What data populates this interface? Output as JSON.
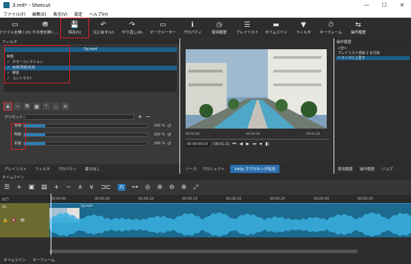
{
  "window": {
    "title": "3.mlt* - Shotcut",
    "minimize": "—",
    "maximize": "☐",
    "close": "✕"
  },
  "menu": [
    "ファイル(F)",
    "編集(E)",
    "表示(V)",
    "設定",
    "ヘルプ(H)"
  ],
  "toolbar": [
    {
      "icon": "▭",
      "label": "ファイルを開く(O)",
      "name": "open-file-button"
    },
    {
      "icon": "⛃",
      "label": "その他を開く...",
      "name": "open-other-button"
    },
    {
      "icon": "💾",
      "label": "保存(S)",
      "name": "save-button",
      "highlight": true
    },
    {
      "icon": "↶",
      "label": "元に戻す(U)",
      "name": "undo-button"
    },
    {
      "icon": "↷",
      "label": "やり直し(R)",
      "name": "redo-button"
    },
    {
      "icon": "▭",
      "label": "ピークメーター",
      "name": "peak-meter-button"
    },
    {
      "icon": "ℹ",
      "label": "プロパティ",
      "name": "properties-button"
    },
    {
      "icon": "◷",
      "label": "使用履歴",
      "name": "recent-button"
    },
    {
      "icon": "☰",
      "label": "プレイリスト",
      "name": "playlist-button"
    },
    {
      "icon": "▬",
      "label": "タイムライン",
      "name": "timeline-button"
    },
    {
      "icon": "▼",
      "label": "フィルタ",
      "name": "filter-button"
    },
    {
      "icon": "⏱",
      "label": "キーフレーム",
      "name": "keyframes-button"
    },
    {
      "icon": "⇆",
      "label": "操作履歴",
      "name": "history-button"
    }
  ],
  "filters": {
    "header": "フィルタ",
    "clip_name": "5g.mp4",
    "section": "映像",
    "items": [
      {
        "check": "✓",
        "label": "カラーコレクション",
        "selected": false
      },
      {
        "check": "✓",
        "label": "色相/明度/彩度",
        "selected": true
      },
      {
        "check": "✓",
        "label": "鮮度",
        "selected": false
      },
      {
        "check": "✓",
        "label": "コントラスト",
        "selected": false
      }
    ],
    "controls": [
      "+",
      "−",
      "⧉",
      "▦",
      "⌃",
      "⌄",
      "✕"
    ],
    "preset_label": "プリセット",
    "preset_add": "+",
    "preset_remove": "−",
    "params": [
      {
        "label": "色相",
        "value": "100",
        "unit": "%",
        "level": 0.17
      },
      {
        "label": "明度",
        "value": "100",
        "unit": "%",
        "level": 0.17
      },
      {
        "label": "彩度",
        "value": "100",
        "unit": "%",
        "level": 0.17
      }
    ],
    "reset": "↺"
  },
  "left_tabs": [
    "プレイリスト",
    "フィルタ",
    "プロパティ",
    "書き出し"
  ],
  "player": {
    "ruler": [
      "00:00:00",
      "00:00:30",
      "00:01:00"
    ],
    "timecode": "00:00:00:03",
    "duration": "/ 00:01:21",
    "buttons": [
      "⏮",
      "◀",
      "▶",
      "⏭",
      "⏹",
      "◧"
    ],
    "tabs": [
      "ソース",
      "プロジェクト"
    ],
    "proxy": "540p でプロキシが有効"
  },
  "history": {
    "header": "操作履歴",
    "items": [
      {
        "label": "<空>",
        "selected": false
      },
      {
        "label": "プレイリスト項目 1 を付加",
        "selected": false
      },
      {
        "label": "トラックに上書き",
        "selected": true
      }
    ]
  },
  "right_tabs": [
    "使用履歴",
    "操作履歴",
    "ジョブ"
  ],
  "timeline": {
    "header": "タイムライン",
    "tools": [
      "☰",
      "+",
      "▣",
      "▤",
      "+",
      "−",
      "∧",
      "∨",
      "⊐⊏",
      "∩",
      "⊶",
      "◎",
      "⊛",
      "⊖",
      "⊕",
      "⤢"
    ],
    "track_header": "出力",
    "track_name": "V1",
    "track_icons": [
      "🔓",
      "🔇",
      "👁"
    ],
    "clip_label": "5g.mp4",
    "ruler": [
      "00:00:00",
      "00:00:05",
      "00:00:10",
      "00:00:15",
      "00:00:20",
      "00:00:25",
      "00:00:30",
      "00:00:35"
    ]
  },
  "bottom_tabs": [
    "タイムライン",
    "キーフレーム"
  ]
}
